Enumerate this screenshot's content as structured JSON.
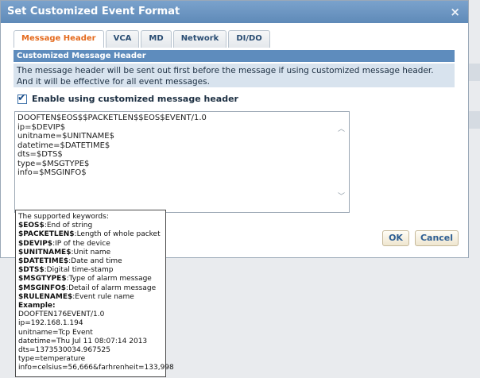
{
  "dialog": {
    "title": "Set Customized Event Format",
    "close_icon": "×"
  },
  "tabs": [
    {
      "label": "Message Header"
    },
    {
      "label": "VCA"
    },
    {
      "label": "MD"
    },
    {
      "label": "Network"
    },
    {
      "label": "DI/DO"
    }
  ],
  "section": {
    "title": "Customized Message Header",
    "description": "The message header will be sent out first before the message if using customized message header. And it will be effective for all event messages."
  },
  "enable": {
    "label": "Enable using customized message header",
    "checked": true
  },
  "header_text": {
    "lines": [
      "DOOFTEN$EOS$$PACKETLEN$$EOS$EVENT/1.0",
      "ip=$DEVIP$",
      "unitname=$UNITNAME$",
      "datetime=$DATETIME$",
      "dts=$DTS$",
      "type=$MSGTYPE$",
      "info=$MSGINFO$"
    ]
  },
  "buttons": {
    "ok": "OK",
    "cancel": "Cancel"
  },
  "tooltip": {
    "intro": "The supported keywords:",
    "keywords": [
      {
        "kw": "$EOS$",
        "desc": ":End of string"
      },
      {
        "kw": "$PACKETLEN$",
        "desc": ":Length of whole packet"
      },
      {
        "kw": "$DEVIP$",
        "desc": ":IP of the device"
      },
      {
        "kw": "$UNITNAME$",
        "desc": ":Unit name"
      },
      {
        "kw": "$DATETIME$",
        "desc": ":Date and time"
      },
      {
        "kw": "$DTS$",
        "desc": ":Digital time-stamp"
      },
      {
        "kw": "$MSGTYPE$",
        "desc": ":Type of alarm message"
      },
      {
        "kw": "$MSGINFO$",
        "desc": ":Detail of alarm message"
      },
      {
        "kw": "$RULENAME$",
        "desc": ":Event rule name"
      }
    ],
    "example_label": "Example:",
    "example_lines": [
      "DOOFTEN176EVENT/1.0",
      "ip=192.168.1.194",
      "unitname=Tcp Event",
      "datetime=Thu Jul 11 08:07:14 2013",
      "dts=1373530034.967525",
      "type=temperature",
      "info=celsius=56,666&farhrenheit=133,998"
    ]
  }
}
